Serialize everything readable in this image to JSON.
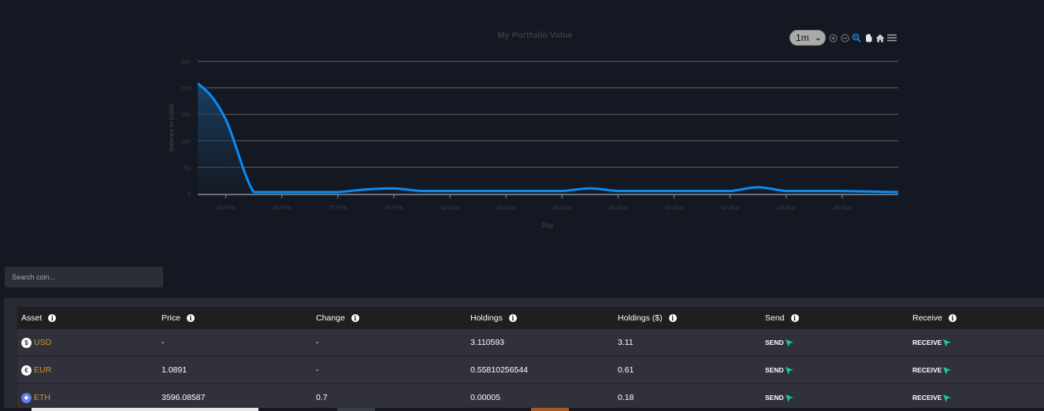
{
  "chart": {
    "range_select": {
      "value": "1m",
      "options_visible": [
        "1m"
      ]
    },
    "toolbar_icons": [
      "zoom-in-icon",
      "zoom-out-icon",
      "selection-zoom-icon",
      "pan-icon",
      "home-reset-icon",
      "menu-icon"
    ]
  },
  "chart_data": {
    "type": "area",
    "title": "My Portfolio Value",
    "xlabel": "Day",
    "ylabel": "Balance In (USD)",
    "ylim": [
      0,
      250
    ],
    "yticks": [
      0,
      50,
      100,
      150,
      200,
      250
    ],
    "xticks": [
      "23 Feb",
      "25 Feb",
      "27 Feb",
      "29 Feb",
      "02 Mar",
      "04 Mar",
      "06 Mar",
      "08 Mar",
      "10 Mar",
      "12 Mar",
      "14 Mar",
      "16 Mar"
    ],
    "grid": true,
    "series": [
      {
        "name": "Balance",
        "color": "#0a8cf5",
        "x": [
          "22 Feb",
          "23 Feb",
          "24 Feb",
          "25 Feb",
          "26 Feb",
          "27 Feb",
          "28 Feb",
          "29 Feb",
          "01 Mar",
          "02 Mar",
          "03 Mar",
          "04 Mar",
          "05 Mar",
          "06 Mar",
          "07 Mar",
          "08 Mar",
          "09 Mar",
          "10 Mar",
          "11 Mar",
          "12 Mar",
          "13 Mar",
          "14 Mar",
          "15 Mar",
          "16 Mar",
          "17 Mar",
          "18 Mar"
        ],
        "values": [
          208,
          140,
          3,
          3,
          3,
          3,
          8,
          10,
          5,
          5,
          5,
          5,
          5,
          5,
          10,
          5,
          5,
          5,
          5,
          5,
          12,
          5,
          5,
          5,
          4,
          3
        ]
      }
    ]
  },
  "search": {
    "placeholder": "Search coin...",
    "value": ""
  },
  "table": {
    "headers": [
      "Asset",
      "Price",
      "Change",
      "Holdings",
      "Holdings ($)",
      "Send",
      "Receive"
    ],
    "rows": [
      {
        "asset": "USD",
        "coin_symbol": "$",
        "coin_bg": "#ffffff",
        "coin_fg": "#333333",
        "price": "-",
        "change": "-",
        "holdings": "3.110593",
        "holdings_usd": "3.11",
        "send": "SEND",
        "receive": "RECEIVE"
      },
      {
        "asset": "EUR",
        "coin_symbol": "€",
        "coin_bg": "#ffffff",
        "coin_fg": "#333333",
        "price": "1.0891",
        "change": "-",
        "holdings": "0.55810256544",
        "holdings_usd": "0.61",
        "send": "SEND",
        "receive": "RECEIVE"
      },
      {
        "asset": "ETH",
        "coin_symbol": "◆",
        "coin_bg": "#627eea",
        "coin_fg": "#ffffff",
        "price": "3596.08587",
        "change": "0.7",
        "holdings": "0.00005",
        "holdings_usd": "0.18",
        "send": "SEND",
        "receive": "RECEIVE"
      }
    ]
  },
  "colors": {
    "accent": "#0a8cf5",
    "asset_name": "#d4962a",
    "send_icon": "#1fc98a",
    "background": "#141822"
  }
}
